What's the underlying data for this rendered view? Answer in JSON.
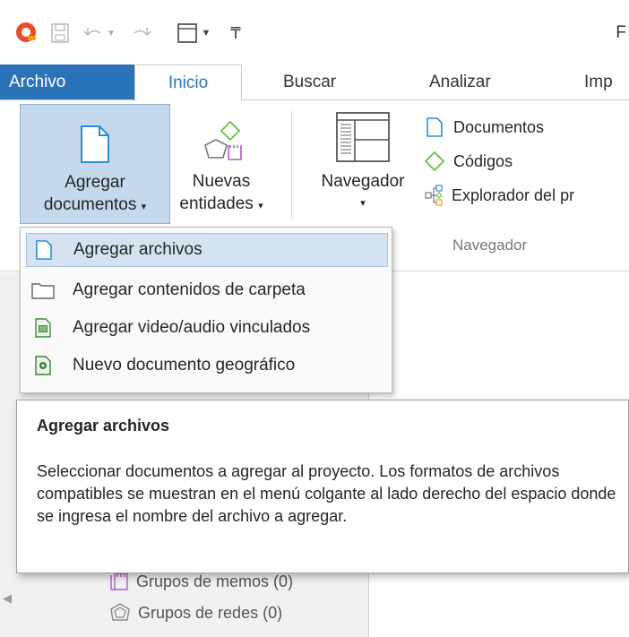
{
  "colors": {
    "accent": "#2b73b8",
    "highlight": "#d5e3f1",
    "code_green": "#6abf40",
    "memo_purple": "#b05ac8"
  },
  "title_initial": "F",
  "quick_access": [
    "app-logo-icon",
    "save-icon",
    "undo-icon",
    "redo-icon",
    "layout-icon",
    "customize-icon"
  ],
  "tabs": {
    "file": "Archivo",
    "home": "Inicio",
    "search": "Buscar",
    "analyze": "Analizar",
    "import": "Imp"
  },
  "ribbon": {
    "add_documents": {
      "line1": "Agregar",
      "line2": "documentos"
    },
    "new_entities": {
      "line1": "Nuevas",
      "line2": "entidades"
    },
    "navigator": {
      "label": "Navegador"
    },
    "links": {
      "documents": "Documentos",
      "codes": "Códigos",
      "explorer": "Explorador del pr"
    },
    "group_navigator": "Navegador"
  },
  "menu": [
    {
      "label": "Agregar archivos",
      "icon": "file-icon"
    },
    {
      "label": "Agregar contenidos de carpeta",
      "icon": "folder-icon"
    },
    {
      "label": "Agregar video/audio vinculados",
      "icon": "video-icon"
    },
    {
      "label": "Nuevo documento geográfico",
      "icon": "geo-icon"
    }
  ],
  "tooltip": {
    "title": "Agregar archivos",
    "body": "Seleccionar documentos a agregar al proyecto. Los formatos de archivos compatibles se muestran en el menú colgante al lado derecho del espacio donde se ingresa el nombre del archivo a agregar."
  },
  "tree": [
    {
      "label": "Grupos de memos (0)",
      "icon": "memo-group-icon"
    },
    {
      "label": "Grupos de redes (0)",
      "icon": "network-group-icon"
    }
  ]
}
